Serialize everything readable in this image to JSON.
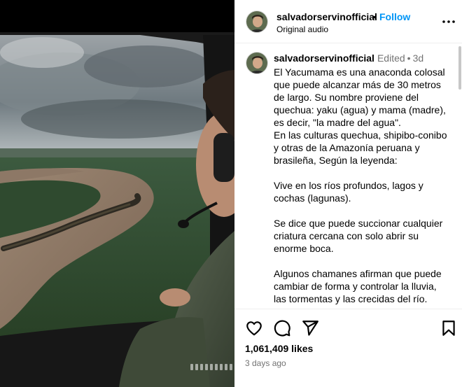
{
  "post": {
    "username": "salvadorservinofficial",
    "follow_label": "Follow",
    "audio": "Original audio",
    "separator": "•"
  },
  "caption": {
    "username": "salvadorservinofficial",
    "edited": "Edited",
    "separator": "•",
    "time": "3d",
    "text": "El Yacumama es una anaconda colosal que puede alcanzar más de 30 metros de largo. Su nombre proviene del quechua: yaku (agua) y mama (madre), es decir, \"la madre del agua\".\nEn las culturas quechua, shipibo-conibo y otras de la Amazonía peruana y brasileña, Según la leyenda:\n\nVive en los ríos profundos, lagos y cochas (lagunas).\n\nSe dice que puede succionar cualquier criatura cercana con solo abrir su enorme boca.\n\nAlgunos chamanes afirman que puede cambiar de forma y controlar la lluvia, las tormentas y las crecidas del río."
  },
  "engagement": {
    "likes": "1,061,409 likes",
    "posted": "3 days ago"
  },
  "icons": {
    "more": "more-options-icon",
    "like": "heart-icon",
    "comment": "comment-icon",
    "share": "share-icon",
    "save": "bookmark-icon"
  },
  "colors": {
    "accent": "#0095f6",
    "muted": "#737373",
    "border": "#efefef"
  }
}
